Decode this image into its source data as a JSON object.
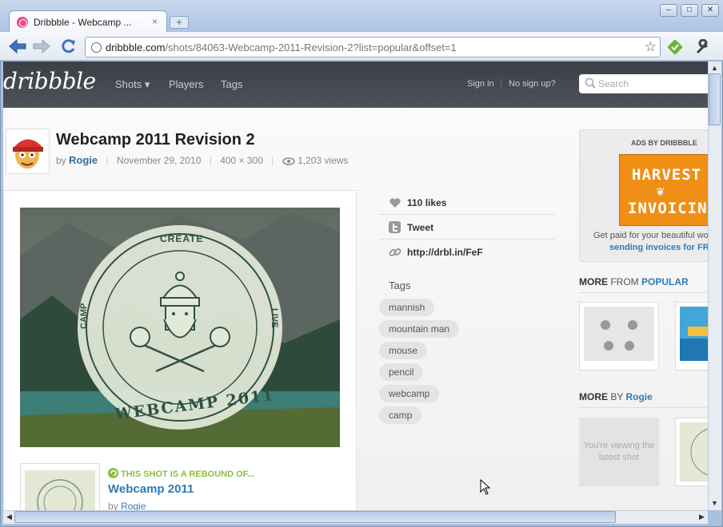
{
  "browser": {
    "tab_title": "Dribbble - Webcamp ...",
    "tab_close": "×",
    "new_tab": "+",
    "url_domain": "dribbble.com",
    "url_path": "/shots/84063-Webcamp-2011-Revision-2?list=popular&offset=1",
    "window_buttons": [
      "–",
      "□",
      "✕"
    ]
  },
  "site": {
    "logo": "dribbble",
    "nav": [
      "Shots ▾",
      "Players",
      "Tags"
    ],
    "sign_in": "Sign in",
    "sign_up": "No sign up?",
    "search_placeholder": "Search"
  },
  "shot": {
    "title": "Webcamp 2011 Revision 2",
    "by": "by",
    "author": "Rogie",
    "date": "November 29, 2010",
    "dimensions": "400 × 300",
    "views": "1,203 views",
    "badge_top": "CREATE",
    "badge_left": "CAMP",
    "badge_right": "LIVE",
    "badge_bottom": "WEBCAMP 2011"
  },
  "stats": {
    "likes": "110 likes",
    "tweet": "Tweet",
    "short_url": "http://drbl.in/FeF"
  },
  "tags": {
    "heading": "Tags",
    "items": [
      "mannish",
      "mountain man",
      "mouse",
      "pencil",
      "webcamp",
      "camp"
    ]
  },
  "rebound": {
    "label": "THIS SHOT IS A REBOUND OF...",
    "title": "Webcamp 2011",
    "by": "by",
    "author": "Rogie"
  },
  "ads": {
    "heading": "ADS BY DRIBBBLE",
    "line1": "HARVEST",
    "line2": "INVOICING",
    "copy1": "Get paid for your beautiful wo",
    "copy2": "sending invoices for FR"
  },
  "more_from": {
    "prefix": "MORE",
    "middle": "FROM",
    "link": "POPULAR"
  },
  "more_by": {
    "prefix": "MORE",
    "middle": "BY",
    "link": "Rogie",
    "latest": "You're viewing the latest shot"
  },
  "colors": {
    "brand_pink": "#ea4c89",
    "link_blue": "#2f7bb7",
    "rebound_green": "#8cbf3e",
    "header_dark": "#44484f"
  }
}
